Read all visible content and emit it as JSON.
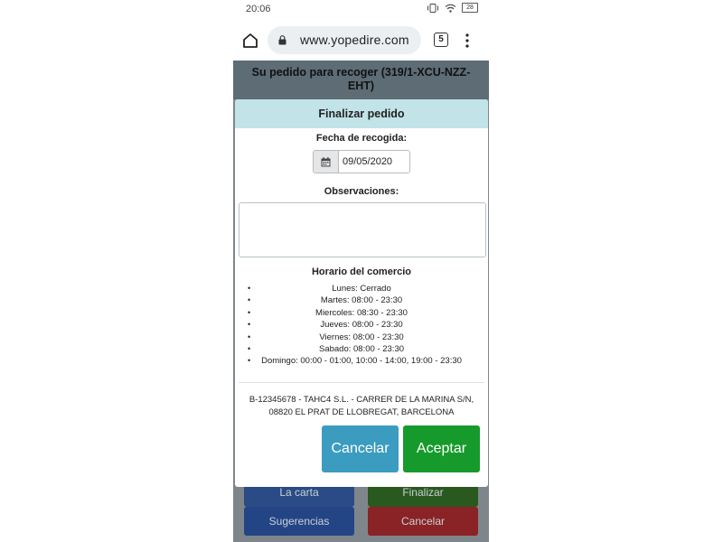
{
  "status_bar": {
    "time": "20:06",
    "battery": "28"
  },
  "browser": {
    "url": "www.yopedire.com",
    "tab_count": "5"
  },
  "page": {
    "title": "Su pedido para recoger (319/1-XCU-NZZ-EHT)",
    "buttons": {
      "carta": "La carta",
      "finalizar": "Finalizar",
      "sugerencias": "Sugerencias",
      "cancelar": "Cancelar"
    }
  },
  "modal": {
    "title": "Finalizar pedido",
    "pickup_date_label": "Fecha de recogida:",
    "pickup_date_value": "09/05/2020",
    "observations_label": "Observaciones:",
    "observations_value": "",
    "hours_title": "Horario del comercio",
    "hours": [
      "Lunes: Cerrado",
      "Martes: 08:00 - 23:30",
      "Miercoles: 08:30 - 23:30",
      "Jueves: 08:00 - 23:30",
      "Viernes: 08:00 - 23:30",
      "Sabado: 08:00 - 23:30",
      "Domingo: 00:00 - 01:00, 10:00 - 14:00, 19:00 - 23:30"
    ],
    "address_line1": "B-12345678 - TAHC4 S.L. - CARRER DE LA MARINA S/N,",
    "address_line2": "08820 EL PRAT DE LLOBREGAT, BARCELONA",
    "cancel_label": "Cancelar",
    "accept_label": "Aceptar"
  },
  "colors": {
    "header_bg": "#5d6c75",
    "modal_header_bg": "#c2e3e8",
    "cancel_bg": "#3b9cc0",
    "accept_bg": "#179a2c"
  }
}
